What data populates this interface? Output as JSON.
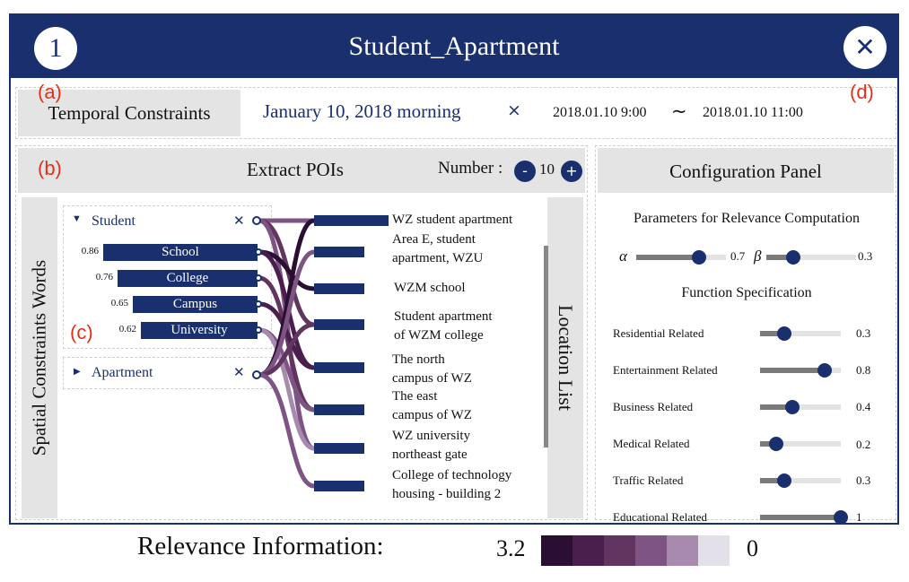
{
  "window": {
    "badge": "1",
    "title": "Student_Apartment",
    "close_icon": "✕"
  },
  "panel_tags": {
    "a": "(a)",
    "b": "(b)",
    "c": "(c)",
    "d": "(d)"
  },
  "temporal": {
    "label": "Temporal Constraints",
    "chip": "January 10, 2018 morning",
    "chip_remove": "×",
    "start": "2018.01.10 9:00",
    "separator": "~",
    "end": "2018.01.10 11:00"
  },
  "extract": {
    "title": "Extract POIs",
    "number_label": "Number :",
    "minus": "-",
    "plus": "+",
    "number_value": "10"
  },
  "spatial_label": "Spatial Constraints Words",
  "location_label": "Location List",
  "groups": [
    {
      "expand_icon": "▼",
      "name": "Student",
      "remove": "✕",
      "words": [
        {
          "score": "0.86",
          "label": "School",
          "value": 0.86
        },
        {
          "score": "0.76",
          "label": "College",
          "value": 0.76
        },
        {
          "score": "0.65",
          "label": "Campus",
          "value": 0.65
        },
        {
          "score": "0.62",
          "label": "University",
          "value": 0.62
        }
      ]
    },
    {
      "expand_icon": "▶",
      "name": "Apartment",
      "remove": "✕"
    }
  ],
  "pois": [
    {
      "lines": [
        "WZ student apartment"
      ]
    },
    {
      "lines": [
        "Area E, student",
        "apartment, WZU"
      ]
    },
    {
      "lines": [
        "WZM school"
      ]
    },
    {
      "lines": [
        "Student apartment",
        "of WZM college"
      ]
    },
    {
      "lines": [
        "The north",
        "campus of WZ"
      ]
    },
    {
      "lines": [
        "The east",
        "campus of WZ"
      ]
    },
    {
      "lines": [
        "WZ university",
        "northeast gate"
      ]
    },
    {
      "lines": [
        "College of technology",
        "housing - building 2"
      ]
    }
  ],
  "config": {
    "title": "Configuration Panel",
    "params_heading": "Parameters for Relevance Computation",
    "alpha": {
      "symbol": "α",
      "value": "0.7",
      "level": 0.7
    },
    "beta": {
      "symbol": "β",
      "value": "0.3",
      "level": 0.3
    },
    "func_heading": "Function Specification",
    "functions": [
      {
        "label": "Residential Related",
        "value": "0.3",
        "level": 0.3
      },
      {
        "label": "Entertainment Related",
        "value": "0.8",
        "level": 0.8
      },
      {
        "label": "Business Related",
        "value": "0.4",
        "level": 0.4
      },
      {
        "label": "Medical Related",
        "value": "0.2",
        "level": 0.2
      },
      {
        "label": "Traffic Related",
        "value": "0.3",
        "level": 0.3
      },
      {
        "label": "Educational Related",
        "value": "1",
        "level": 1.0
      }
    ]
  },
  "legend": {
    "label": "Relevance Information:",
    "max": "3.2",
    "min": "0",
    "colors": [
      "#2b0f33",
      "#4a1f4e",
      "#623460",
      "#7d5484",
      "#a78aad",
      "#e3e0ea"
    ]
  }
}
